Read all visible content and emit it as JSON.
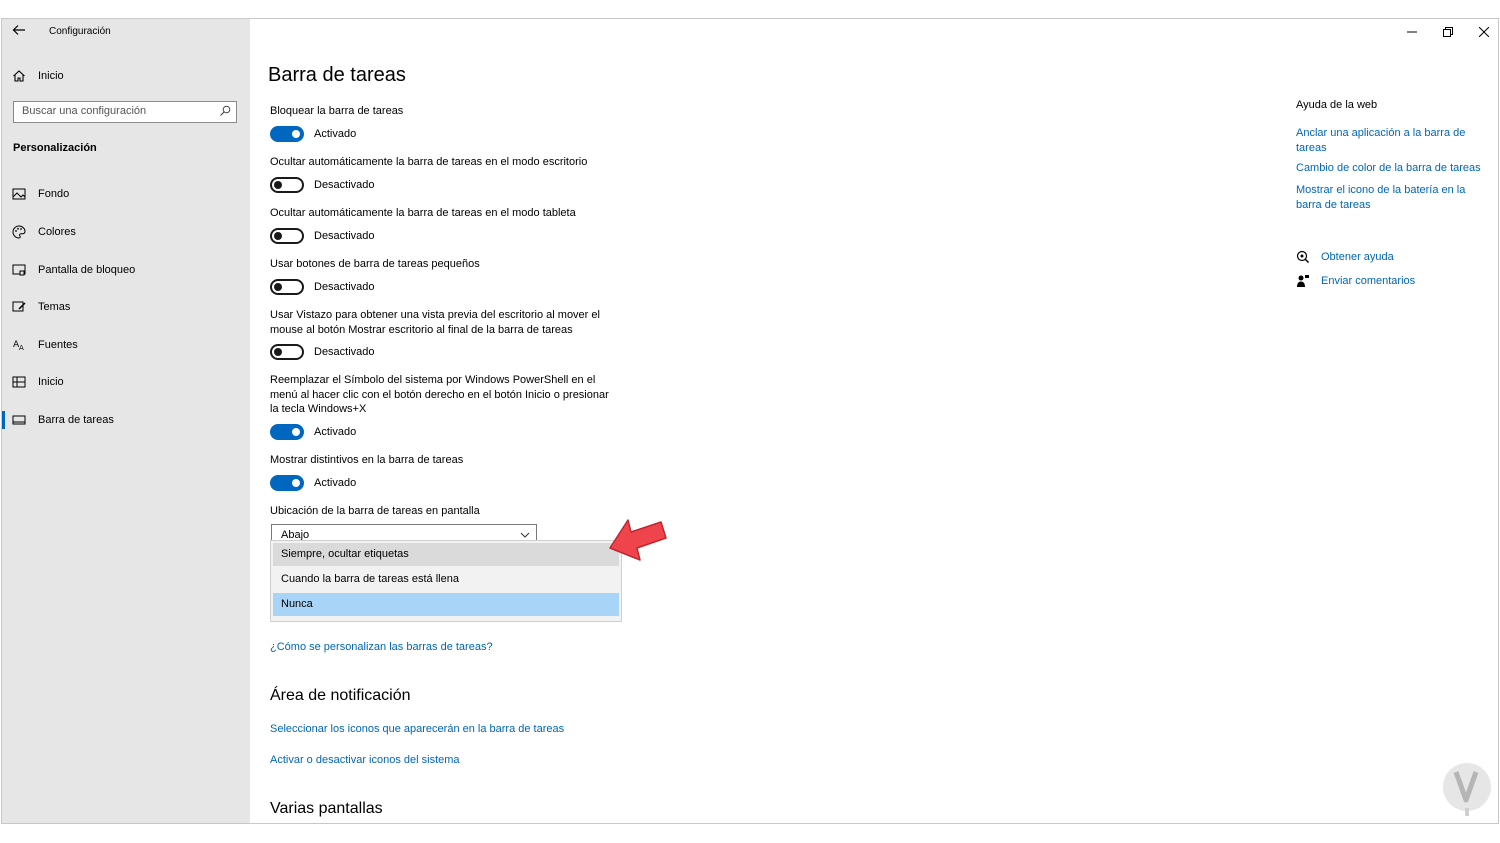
{
  "window": {
    "app_title": "Configuración"
  },
  "sidebar": {
    "home_label": "Inicio",
    "search_placeholder": "Buscar una configuración",
    "section_title": "Personalización",
    "items": [
      {
        "label": "Fondo",
        "icon": "image-icon"
      },
      {
        "label": "Colores",
        "icon": "palette-icon"
      },
      {
        "label": "Pantalla de bloqueo",
        "icon": "lock-screen-icon"
      },
      {
        "label": "Temas",
        "icon": "brush-icon"
      },
      {
        "label": "Fuentes",
        "icon": "font-icon"
      },
      {
        "label": "Inicio",
        "icon": "start-icon"
      },
      {
        "label": "Barra de tareas",
        "icon": "taskbar-icon",
        "active": true
      }
    ]
  },
  "main": {
    "page_title": "Barra de tareas",
    "settings": [
      {
        "label": "Bloquear la barra de tareas",
        "state": "Activado"
      },
      {
        "label": "Ocultar automáticamente la barra de tareas en el modo escritorio",
        "state": "Desactivado"
      },
      {
        "label": "Ocultar automáticamente la barra de tareas en el modo tableta",
        "state": "Desactivado"
      },
      {
        "label": "Usar botones de barra de tareas pequeños",
        "state": "Desactivado"
      },
      {
        "label": "Usar Vistazo para obtener una vista previa del escritorio al mover el mouse al botón Mostrar escritorio al final de la barra de tareas",
        "state": "Desactivado"
      },
      {
        "label": "Reemplazar el Símbolo del sistema por Windows PowerShell en el menú al hacer clic con el botón derecho en el botón Inicio o presionar la tecla Windows+X",
        "state": "Activado"
      },
      {
        "label": "Mostrar distintivos en la barra de tareas",
        "state": "Activado"
      }
    ],
    "location_label": "Ubicación de la barra de tareas en pantalla",
    "location_value": "Abajo",
    "combine_options": [
      "Siempre, ocultar etiquetas",
      "Cuando la barra de tareas está llena",
      "Nunca"
    ],
    "help_link": "¿Cómo se personalizan las barras de tareas?",
    "notification_heading": "Área de notificación",
    "notification_links": [
      "Seleccionar los iconos que aparecerán en la barra de tareas",
      "Activar o desactivar iconos del sistema"
    ],
    "multi_display_heading": "Varias pantallas"
  },
  "right_panel": {
    "web_help_title": "Ayuda de la web",
    "web_links": [
      "Anclar una aplicación a la barra de tareas",
      "Cambio de color de la barra de tareas",
      "Mostrar el icono de la batería en la barra de tareas"
    ],
    "get_help": "Obtener ayuda",
    "feedback": "Enviar comentarios"
  },
  "colors": {
    "accent": "#0067c0",
    "link": "#0066b4",
    "sidebar_bg": "#e6e6e6",
    "selected_option": "#a8d5f7",
    "arrow": "#f0444c"
  }
}
